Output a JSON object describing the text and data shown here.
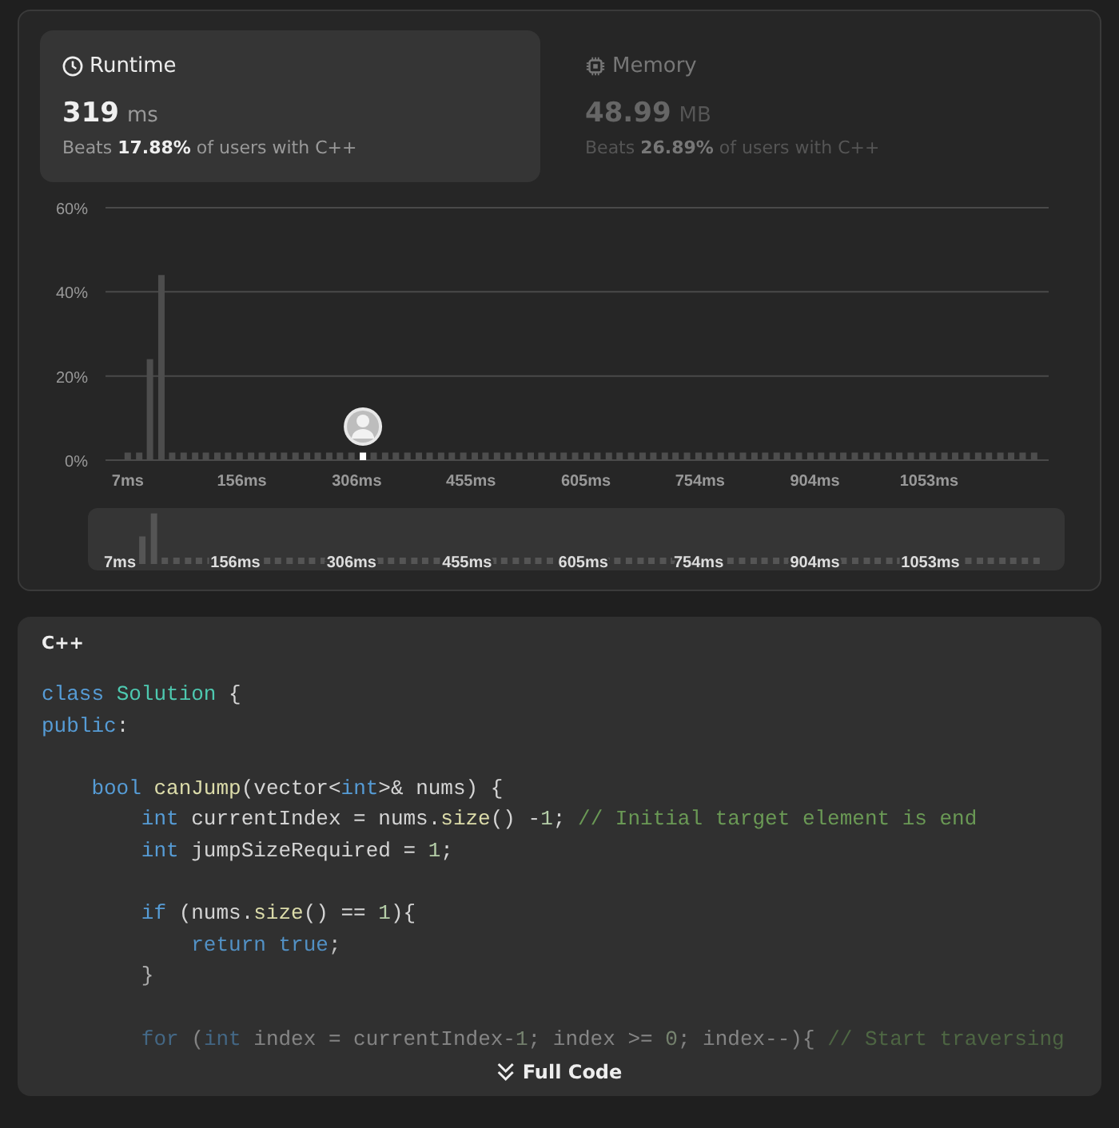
{
  "tabs": [
    {
      "kind": "runtime",
      "title": "Runtime",
      "value": "319",
      "unit": "ms",
      "beats": "Beats **17.88%** of users with C++",
      "selected": true
    },
    {
      "kind": "memory",
      "title": "Memory",
      "value": "48.99",
      "unit": "MB",
      "beats": "Beats **26.89%** of users with C++",
      "selected": false
    }
  ],
  "chart": {
    "chart_data": {
      "type": "bar",
      "xlim": [
        -22,
        1209
      ],
      "ylim": [
        0,
        60
      ],
      "yticks": [
        {
          "value": 0,
          "label": "0%"
        },
        {
          "value": 20,
          "label": "20%"
        },
        {
          "value": 40,
          "label": "40%"
        },
        {
          "value": 60,
          "label": "60%"
        }
      ],
      "xticks": [
        {
          "value": 7,
          "label": "7ms"
        },
        {
          "value": 156,
          "label": "156ms"
        },
        {
          "value": 306,
          "label": "306ms"
        },
        {
          "value": 455,
          "label": "455ms"
        },
        {
          "value": 605,
          "label": "605ms"
        },
        {
          "value": 754,
          "label": "754ms"
        },
        {
          "value": 904,
          "label": "904ms"
        },
        {
          "value": 1053,
          "label": "1053ms"
        }
      ],
      "x": [
        7,
        22,
        36,
        51,
        65,
        80,
        95,
        109,
        124,
        138,
        153,
        168,
        182,
        197,
        211,
        226,
        241,
        255,
        270,
        284,
        299,
        314,
        328,
        343,
        357,
        372,
        387,
        401,
        416,
        430,
        445,
        460,
        474,
        489,
        503,
        518,
        533,
        547,
        562,
        576,
        591,
        606,
        620,
        635,
        649,
        664,
        679,
        693,
        708,
        722,
        737,
        752,
        766,
        781,
        795,
        810,
        825,
        839,
        854,
        868,
        883,
        898,
        912,
        927,
        941,
        956,
        971,
        985,
        1000,
        1014,
        1029,
        1044,
        1058,
        1073,
        1087,
        1102,
        1117,
        1131,
        1146,
        1160,
        1175,
        1190
      ],
      "values": [
        1.8,
        1.8,
        24,
        44,
        1.8,
        1.8,
        1.8,
        1.8,
        1.8,
        1.8,
        1.8,
        1.8,
        1.8,
        1.8,
        1.8,
        1.8,
        1.8,
        1.8,
        1.8,
        1.8,
        1.8,
        1.8,
        1.8,
        1.8,
        1.8,
        1.8,
        1.8,
        1.8,
        1.8,
        1.8,
        1.8,
        1.8,
        1.8,
        1.8,
        1.8,
        1.8,
        1.8,
        1.8,
        1.8,
        1.8,
        1.8,
        1.8,
        1.8,
        1.8,
        1.8,
        1.8,
        1.8,
        1.8,
        1.8,
        1.8,
        1.8,
        1.8,
        1.8,
        1.8,
        1.8,
        1.8,
        1.8,
        1.8,
        1.8,
        1.8,
        1.8,
        1.8,
        1.8,
        1.8,
        1.8,
        1.8,
        1.8,
        1.8,
        1.8,
        1.8,
        1.8,
        1.8,
        1.8,
        1.8,
        1.8,
        1.8,
        1.8,
        1.8,
        1.8,
        1.8,
        1.8,
        1.8
      ]
    }
  },
  "navigator": {
    "labels": [
      "7ms",
      "156ms",
      "306ms",
      "455ms",
      "605ms",
      "754ms",
      "904ms",
      "1053ms"
    ]
  },
  "code": {
    "language": "C++",
    "lines": [
      {
        "kind": "code",
        "tokens": [
          {
            "kind": "kw",
            "text": "class"
          },
          {
            "kind": "type",
            "text": " Solution"
          },
          {
            "kind": "txt",
            "text": " {"
          }
        ]
      },
      {
        "kind": "code",
        "tokens": [
          {
            "kind": "kw",
            "text": "public"
          },
          {
            "kind": "txt",
            "text": ":"
          }
        ]
      },
      {
        "kind": "blank"
      },
      {
        "kind": "code",
        "tokens": [
          {
            "kind": "kw",
            "text": "    bool"
          },
          {
            "kind": "fn",
            "text": " canJump"
          },
          {
            "kind": "txt",
            "text": "(vector<"
          },
          {
            "kind": "kw",
            "text": "int"
          },
          {
            "kind": "txt",
            "text": ">& nums) {"
          }
        ]
      },
      {
        "kind": "code",
        "tokens": [
          {
            "kind": "kw",
            "text": "        int"
          },
          {
            "kind": "txt",
            "text": " currentIndex = nums."
          },
          {
            "kind": "fn",
            "text": "size"
          },
          {
            "kind": "txt",
            "text": "() -"
          },
          {
            "kind": "num",
            "text": "1"
          },
          {
            "kind": "txt",
            "text": ";"
          },
          {
            "kind": "cm",
            "text": " // Initial target element is end"
          }
        ]
      },
      {
        "kind": "code",
        "tokens": [
          {
            "kind": "kw",
            "text": "        int"
          },
          {
            "kind": "txt",
            "text": " jumpSizeRequired = "
          },
          {
            "kind": "num",
            "text": "1"
          },
          {
            "kind": "txt",
            "text": ";"
          }
        ]
      },
      {
        "kind": "blank"
      },
      {
        "kind": "code",
        "tokens": [
          {
            "kind": "kw",
            "text": "        if"
          },
          {
            "kind": "txt",
            "text": " (nums."
          },
          {
            "kind": "fn",
            "text": "size"
          },
          {
            "kind": "txt",
            "text": "() == "
          },
          {
            "kind": "num",
            "text": "1"
          },
          {
            "kind": "txt",
            "text": "){"
          }
        ]
      },
      {
        "kind": "code",
        "tokens": [
          {
            "kind": "kw",
            "text": "            return"
          },
          {
            "kind": "kw",
            "text": " true"
          },
          {
            "kind": "txt",
            "text": ";"
          }
        ]
      },
      {
        "kind": "code",
        "tokens": [
          {
            "kind": "txt",
            "text": "        }"
          }
        ]
      },
      {
        "kind": "blank"
      },
      {
        "kind": "code",
        "tokens": [
          {
            "kind": "kw",
            "text": "        for"
          },
          {
            "kind": "txt",
            "text": " ("
          },
          {
            "kind": "kw",
            "text": "int"
          },
          {
            "kind": "txt",
            "text": " index = currentIndex-"
          },
          {
            "kind": "num",
            "text": "1"
          },
          {
            "kind": "txt",
            "text": "; index >= "
          },
          {
            "kind": "num",
            "text": "0"
          },
          {
            "kind": "txt",
            "text": "; index--){"
          },
          {
            "kind": "cm",
            "text": " // Start traversing"
          }
        ]
      }
    ]
  },
  "expand_button": {
    "label": "Full Code"
  }
}
